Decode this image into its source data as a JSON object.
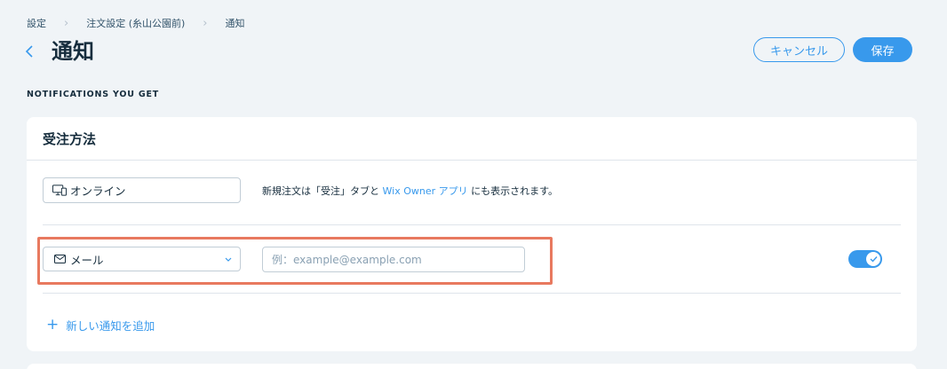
{
  "breadcrumb": {
    "items": [
      "設定",
      "注文設定 (糸山公園前)",
      "通知"
    ]
  },
  "header": {
    "title": "通知",
    "cancel_label": "キャンセル",
    "save_label": "保存"
  },
  "section": {
    "label": "NOTIFICATIONS YOU GET"
  },
  "card": {
    "title": "受注方法",
    "online": {
      "channel_label": "オンライン",
      "icon": "desktop-mobile-icon",
      "note_prefix": "新規注文は「受注」タブと ",
      "note_link": "Wix Owner アプリ",
      "note_suffix": " にも表示されます。"
    },
    "email": {
      "channel_label": "メール",
      "icon": "mail-icon",
      "placeholder": "例：example@example.com",
      "value": "",
      "enabled": true
    },
    "add_label": "新しい通知を追加"
  },
  "colors": {
    "accent": "#3899ec",
    "highlight": "#e8795f",
    "background": "#f0f4f7"
  }
}
